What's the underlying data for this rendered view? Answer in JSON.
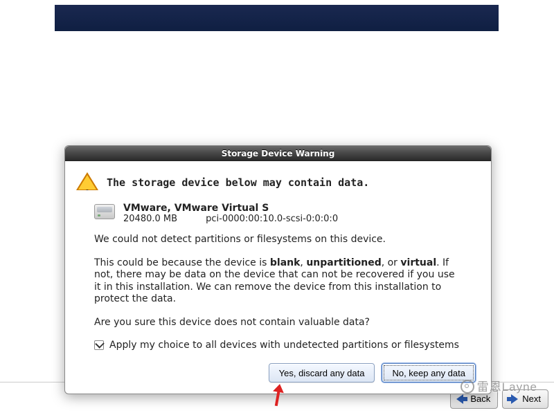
{
  "dialog": {
    "title": "Storage Device Warning",
    "heading": "The storage device below may contain data.",
    "device": {
      "name": "VMware, VMware Virtual S",
      "size": "20480.0 MB",
      "path": "pci-0000:00:10.0-scsi-0:0:0:0"
    },
    "para1": "We could not detect partitions or filesystems on this device.",
    "para2_a": "This could be because the device is ",
    "para2_blank": "blank",
    "para2_comma1": ", ",
    "para2_unpart": "unpartitioned",
    "para2_comma2": ", or ",
    "para2_virtual": "virtual",
    "para2_b": ". If not, there may be data on the device that can not be recovered if you use it in this installation. We can remove the device from this installation to protect the data.",
    "para3": "Are you sure this device does not contain valuable data?",
    "checkbox_label": "Apply my choice to all devices with undetected partitions or filesystems",
    "checkbox_checked": true,
    "buttons": {
      "yes": "Yes, discard any data",
      "no": "No, keep any data"
    }
  },
  "nav": {
    "back": "Back",
    "next": "Next"
  },
  "watermark": "雷恩Layne"
}
